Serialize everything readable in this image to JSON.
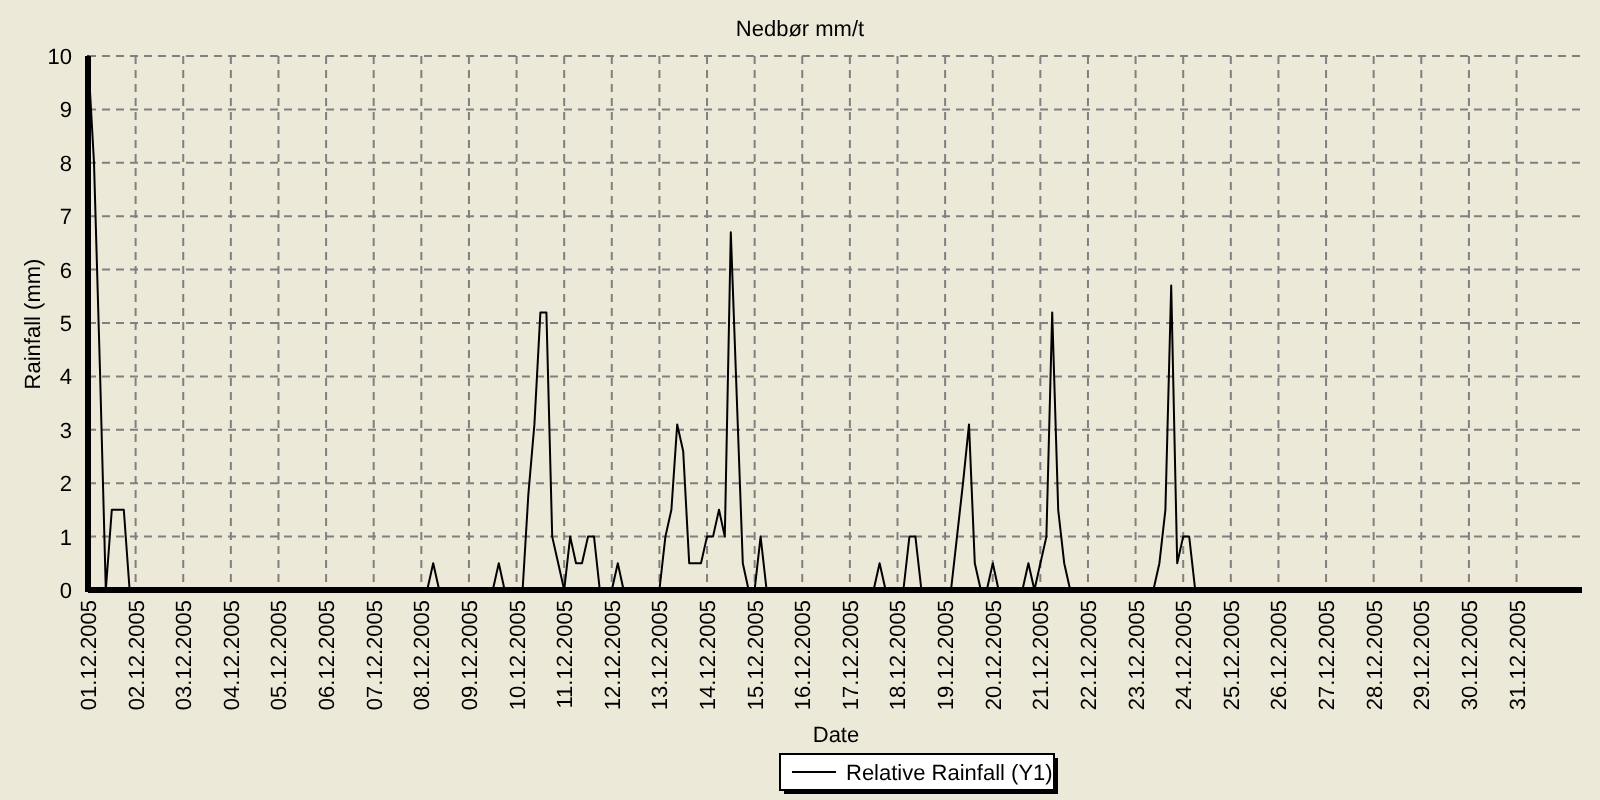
{
  "chart": {
    "chart_data": {
      "type": "line",
      "grid": true,
      "title": "Nedbør mm/t",
      "xlabel": "Date",
      "ylabel": "Rainfall (mm)",
      "ylim": [
        0,
        10
      ],
      "yticks": [
        0,
        1,
        2,
        3,
        4,
        5,
        6,
        7,
        8,
        9,
        10
      ],
      "categories": [
        "01.12.2005",
        null,
        null,
        null,
        null,
        null,
        null,
        null,
        "02.12.2005",
        null,
        null,
        null,
        null,
        null,
        null,
        null,
        "03.12.2005",
        null,
        null,
        null,
        null,
        null,
        null,
        null,
        "04.12.2005",
        null,
        null,
        null,
        null,
        null,
        null,
        null,
        "05.12.2005",
        null,
        null,
        null,
        null,
        null,
        null,
        null,
        "06.12.2005",
        null,
        null,
        null,
        null,
        null,
        null,
        null,
        "07.12.2005",
        null,
        null,
        null,
        null,
        null,
        null,
        null,
        "08.12.2005",
        null,
        null,
        null,
        null,
        null,
        null,
        null,
        "09.12.2005",
        null,
        null,
        null,
        null,
        null,
        null,
        null,
        "10.12.2005",
        null,
        null,
        null,
        null,
        null,
        null,
        null,
        "11.12.2005",
        null,
        null,
        null,
        null,
        null,
        null,
        null,
        "12.12.2005",
        null,
        null,
        null,
        null,
        null,
        null,
        null,
        "13.12.2005",
        null,
        null,
        null,
        null,
        null,
        null,
        null,
        "14.12.2005",
        null,
        null,
        null,
        null,
        null,
        null,
        null,
        "15.12.2005",
        null,
        null,
        null,
        null,
        null,
        null,
        null,
        "16.12.2005",
        null,
        null,
        null,
        null,
        null,
        null,
        null,
        "17.12.2005",
        null,
        null,
        null,
        null,
        null,
        null,
        null,
        "18.12.2005",
        null,
        null,
        null,
        null,
        null,
        null,
        null,
        "19.12.2005",
        null,
        null,
        null,
        null,
        null,
        null,
        null,
        "20.12.2005",
        null,
        null,
        null,
        null,
        null,
        null,
        null,
        "21.12.2005",
        null,
        null,
        null,
        null,
        null,
        null,
        null,
        "22.12.2005",
        null,
        null,
        null,
        null,
        null,
        null,
        null,
        "23.12.2005",
        null,
        null,
        null,
        null,
        null,
        null,
        null,
        "24.12.2005",
        null,
        null,
        null,
        null,
        null,
        null,
        null,
        "25.12.2005",
        null,
        null,
        null,
        null,
        null,
        null,
        null,
        "26.12.2005",
        null,
        null,
        null,
        null,
        null,
        null,
        null,
        "27.12.2005",
        null,
        null,
        null,
        null,
        null,
        null,
        null,
        "28.12.2005",
        null,
        null,
        null,
        null,
        null,
        null,
        null,
        "29.12.2005",
        null,
        null,
        null,
        null,
        null,
        null,
        null,
        "30.12.2005",
        null,
        null,
        null,
        null,
        null,
        null,
        null,
        "31.12.2005",
        null,
        null
      ],
      "series": [
        {
          "name": "Relative Rainfall (Y1)",
          "color": "#000000",
          "values": [
            10,
            8,
            4.1,
            0,
            1.5,
            1.5,
            1.5,
            0,
            0,
            0,
            0,
            0,
            0,
            0,
            0,
            0,
            0,
            0,
            0,
            0,
            0,
            0,
            0,
            0,
            0,
            0,
            0,
            0,
            0,
            0,
            0,
            0,
            0,
            0,
            0,
            0,
            0,
            0,
            0,
            0,
            0,
            0,
            0,
            0,
            0,
            0,
            0,
            0,
            0,
            0,
            0,
            0,
            0,
            0,
            0,
            0,
            0,
            0,
            0.5,
            0,
            0,
            0,
            0,
            0,
            0,
            0,
            0,
            0,
            0,
            0.5,
            0,
            0,
            0,
            0,
            1.8,
            3.1,
            5.2,
            5.2,
            1,
            0.5,
            0,
            1,
            0.5,
            0.5,
            1,
            1,
            0,
            0,
            0,
            0.5,
            0,
            0,
            0,
            0,
            0,
            0,
            0,
            1,
            1.5,
            3.1,
            2.6,
            0.5,
            0.5,
            0.5,
            1,
            1,
            1.5,
            1,
            6.7,
            3.6,
            0.5,
            0,
            0,
            1,
            0,
            0,
            0,
            0,
            0,
            0,
            0,
            0,
            0,
            0,
            0,
            0,
            0,
            0,
            0,
            0,
            0,
            0,
            0,
            0.5,
            0,
            0,
            0,
            0,
            1,
            1,
            0,
            0,
            0,
            0,
            0,
            0,
            1,
            2,
            3.1,
            0.5,
            0,
            0,
            0.5,
            0,
            0,
            0,
            0,
            0,
            0.5,
            0,
            0.5,
            1,
            5.2,
            1.5,
            0.5,
            0,
            0,
            0,
            0,
            0,
            0,
            0,
            0,
            0,
            0,
            0,
            0,
            0,
            0,
            0,
            0.5,
            1.5,
            5.7,
            0.5,
            1,
            1,
            0,
            0,
            0,
            0,
            0,
            0,
            0,
            0,
            0,
            0,
            0,
            0,
            0,
            0,
            0,
            0,
            0,
            0,
            0,
            0,
            0,
            0,
            0,
            0,
            0,
            0,
            0,
            0,
            0,
            0,
            0,
            0,
            0,
            0,
            0,
            0,
            0,
            0,
            0,
            0,
            0,
            0,
            0,
            0,
            0,
            0,
            0,
            0,
            0,
            0,
            0,
            0,
            0,
            0,
            0,
            0,
            0
          ]
        }
      ]
    }
  }
}
